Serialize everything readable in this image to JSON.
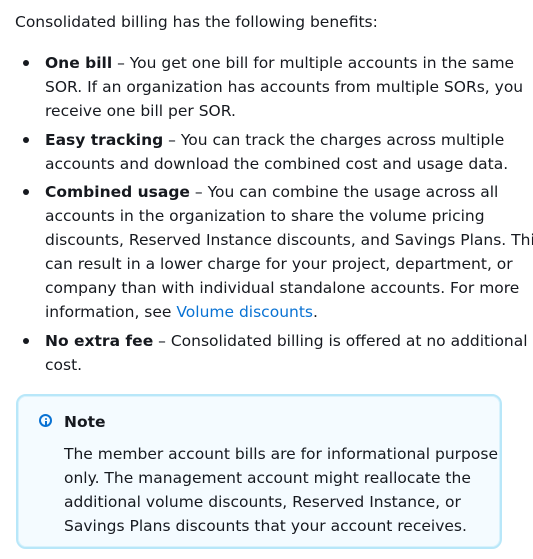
{
  "intro": "Consolidated billing has the following benefits:",
  "benefits": [
    {
      "term": "One bill",
      "separator": " – ",
      "lines": [
        "You get one bill for multiple accounts in the same",
        "SOR. If an organization has accounts from multiple SORs, you",
        "receive one bill per SOR."
      ]
    },
    {
      "term": "Easy tracking",
      "separator": " – ",
      "lines": [
        "You can track the charges across multiple",
        "accounts and download the combined cost and usage data."
      ]
    },
    {
      "term": "Combined usage",
      "separator": " – ",
      "lines": [
        "You can combine the usage across all",
        "accounts in the organization to share the volume pricing",
        "discounts, Reserved Instance discounts, and Savings Plans. This",
        "can result in a lower charge for your project, department, or",
        "company than with individual standalone accounts. For more"
      ],
      "last_line_prefix": "information, see ",
      "link_text": "Volume discounts",
      "last_line_suffix": "."
    },
    {
      "term": "No extra fee",
      "separator": " – ",
      "lines": [
        "Consolidated billing is offered at no additional",
        "cost."
      ]
    }
  ],
  "note": {
    "icon": "info-circle-icon",
    "title": "Note",
    "lines": [
      "The member account bills are for informational purpose",
      "only. The management account might reallocate the",
      "additional volume discounts, Reserved Instance, or",
      "Savings Plans discounts that your account receives."
    ]
  },
  "colors": {
    "text": "#16191f",
    "link": "#0972d3",
    "note_border": "#b8e7f9",
    "note_background": "#f4fbff",
    "info_icon": "#0972d3"
  }
}
